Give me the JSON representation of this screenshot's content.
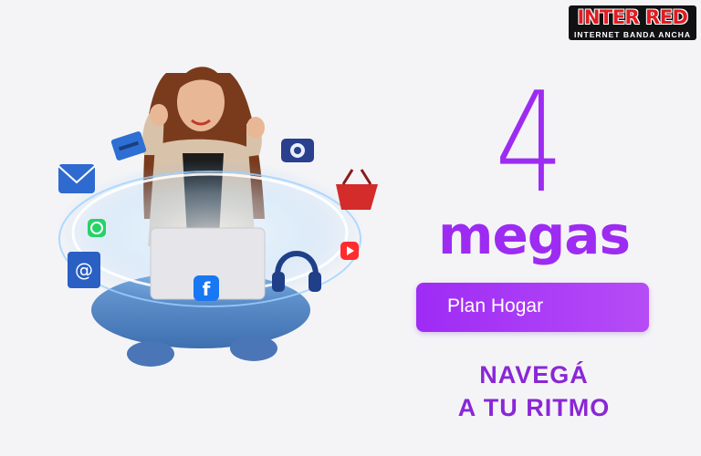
{
  "brand": {
    "logo_top": "INTER RED",
    "logo_bottom": "INTERNET BANDA ANCHA"
  },
  "offer": {
    "speed_value": "4",
    "speed_unit": "megas",
    "plan_label": "Plan Hogar",
    "slogan_line1": "NAVEGÁ",
    "slogan_line2": "A TU RITMO"
  },
  "icons": [
    "credit-card-icon",
    "envelope-icon",
    "whatsapp-icon",
    "email-at-icon",
    "facebook-icon",
    "camera-icon",
    "shopping-basket-icon",
    "youtube-icon",
    "headphones-icon",
    "laptop-icon"
  ],
  "colors": {
    "accent": "#9d2bf2",
    "pill": "#a83ff5",
    "slogan": "#8a27d6",
    "brand_red": "#e11b22",
    "background": "#f4f4f6"
  }
}
